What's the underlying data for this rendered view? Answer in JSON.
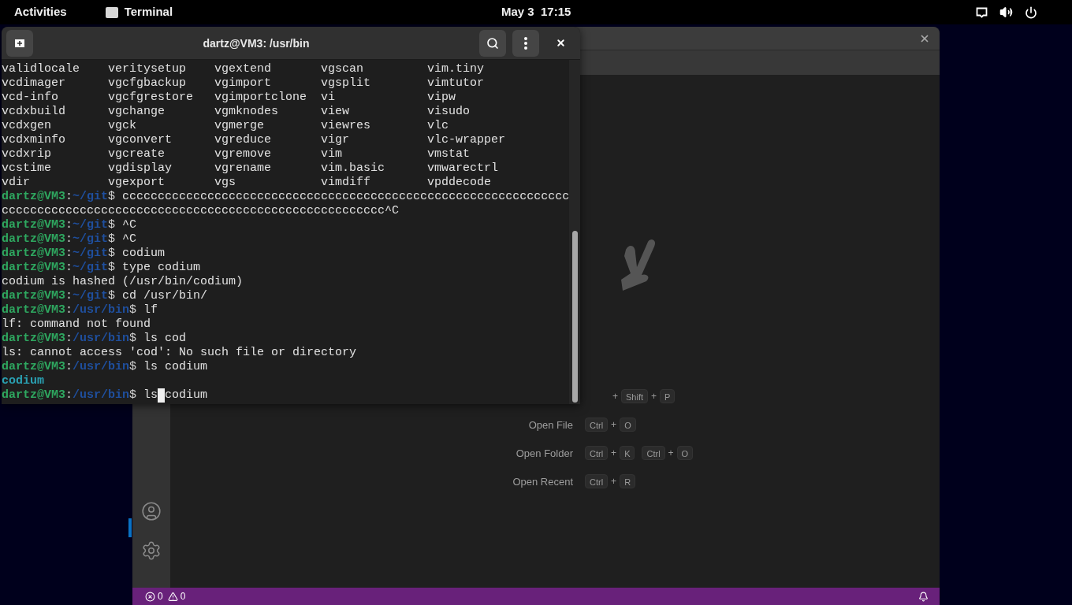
{
  "top_bar": {
    "activities": "Activities",
    "app_name": "Terminal",
    "clock": "May 3  17:15"
  },
  "terminal": {
    "title": "dartz@VM3: /usr/bin",
    "listing": [
      [
        "validlocale",
        "veritysetup",
        "vgextend",
        "vgscan",
        "vim.tiny"
      ],
      [
        "vcdimager",
        "vgcfgbackup",
        "vgimport",
        "vgsplit",
        "vimtutor"
      ],
      [
        "vcd-info",
        "vgcfgrestore",
        "vgimportclone",
        "vi",
        "vipw"
      ],
      [
        "vcdxbuild",
        "vgchange",
        "vgmknodes",
        "view",
        "visudo"
      ],
      [
        "vcdxgen",
        "vgck",
        "vgmerge",
        "viewres",
        "vlc"
      ],
      [
        "vcdxminfo",
        "vgconvert",
        "vgreduce",
        "vigr",
        "vlc-wrapper"
      ],
      [
        "vcdxrip",
        "vgcreate",
        "vgremove",
        "vim",
        "vmstat"
      ],
      [
        "vcstime",
        "vgdisplay",
        "vgrename",
        "vim.basic",
        "vmwarectrl"
      ],
      [
        "vdir",
        "vgexport",
        "vgs",
        "vimdiff",
        "vpddecode"
      ]
    ],
    "lines": [
      {
        "kind": "prompt",
        "user": "dartz@VM3",
        "sep": ":",
        "path": "~/git",
        "sign": "$",
        "command": "ccccccccccccccccccccccccccccccccccccccccccccccccccccccccccccccc",
        "cursor": false
      },
      {
        "kind": "output",
        "text": "cccccccccccccccccccccccccccccccccccccccccccccccccccccc^C"
      },
      {
        "kind": "prompt",
        "user": "dartz@VM3",
        "sep": ":",
        "path": "~/git",
        "sign": "$",
        "command": "^C",
        "cursor": false
      },
      {
        "kind": "prompt",
        "user": "dartz@VM3",
        "sep": ":",
        "path": "~/git",
        "sign": "$",
        "command": "^C",
        "cursor": false
      },
      {
        "kind": "prompt",
        "user": "dartz@VM3",
        "sep": ":",
        "path": "~/git",
        "sign": "$",
        "command": "codium",
        "cursor": false
      },
      {
        "kind": "prompt",
        "user": "dartz@VM3",
        "sep": ":",
        "path": "~/git",
        "sign": "$",
        "command": "type codium",
        "cursor": false
      },
      {
        "kind": "output",
        "text": "codium is hashed (/usr/bin/codium)"
      },
      {
        "kind": "prompt",
        "user": "dartz@VM3",
        "sep": ":",
        "path": "~/git",
        "sign": "$",
        "command": "cd /usr/bin/",
        "cursor": false
      },
      {
        "kind": "prompt",
        "user": "dartz@VM3",
        "sep": ":",
        "path": "/usr/bin",
        "sign": "$",
        "command": "lf",
        "cursor": false
      },
      {
        "kind": "output",
        "text": "lf: command not found"
      },
      {
        "kind": "prompt",
        "user": "dartz@VM3",
        "sep": ":",
        "path": "/usr/bin",
        "sign": "$",
        "command": "ls cod",
        "cursor": false
      },
      {
        "kind": "output",
        "text": "ls: cannot access 'cod': No such file or directory"
      },
      {
        "kind": "prompt",
        "user": "dartz@VM3",
        "sep": ":",
        "path": "/usr/bin",
        "sign": "$",
        "command": "ls codium",
        "cursor": false
      },
      {
        "kind": "file",
        "text": "codium"
      },
      {
        "kind": "prompt",
        "user": "dartz@VM3",
        "sep": ":",
        "path": "/usr/bin",
        "sign": "$",
        "command": "ls",
        "cursor": true,
        "rest": "codium"
      }
    ]
  },
  "editor": {
    "shortcuts": [
      {
        "keys": [
          {
            "kind": "plus",
            "text": "+"
          },
          {
            "kind": "key",
            "text": "Shift"
          },
          {
            "kind": "plus",
            "text": "+"
          },
          {
            "kind": "key",
            "text": "P"
          }
        ]
      },
      {
        "label": "Open File",
        "keys": [
          {
            "kind": "key",
            "text": "Ctrl"
          },
          {
            "kind": "plus",
            "text": "+"
          },
          {
            "kind": "key",
            "text": "O"
          }
        ]
      },
      {
        "label": "Open Folder",
        "keys": [
          {
            "kind": "key",
            "text": "Ctrl"
          },
          {
            "kind": "plus",
            "text": "+"
          },
          {
            "kind": "key",
            "text": "K"
          },
          {
            "kind": "gap"
          },
          {
            "kind": "key",
            "text": "Ctrl"
          },
          {
            "kind": "plus",
            "text": "+"
          },
          {
            "kind": "key",
            "text": "O"
          }
        ]
      },
      {
        "label": "Open Recent",
        "keys": [
          {
            "kind": "key",
            "text": "Ctrl"
          },
          {
            "kind": "plus",
            "text": "+"
          },
          {
            "kind": "key",
            "text": "R"
          }
        ]
      }
    ],
    "status_bar": {
      "errors": "0",
      "warnings": "0"
    }
  }
}
